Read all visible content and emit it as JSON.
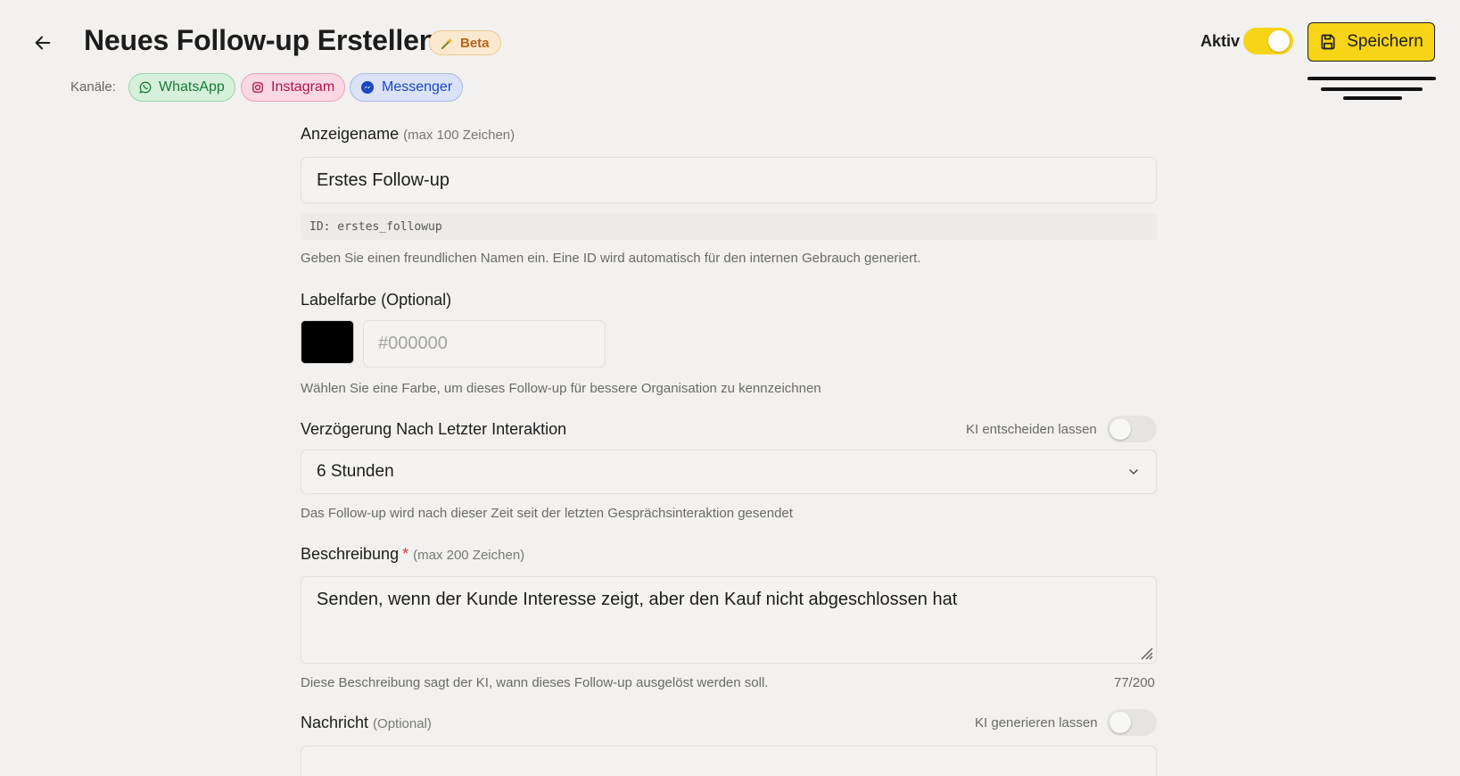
{
  "header": {
    "title": "Neues Follow-up Erstellen",
    "beta_badge": "Beta",
    "channels_label": "Kanäle:",
    "channels": [
      {
        "label": "WhatsApp",
        "icon": "whatsapp-icon",
        "color": "#187a33"
      },
      {
        "label": "Instagram",
        "icon": "instagram-icon",
        "color": "#b2124f"
      },
      {
        "label": "Messenger",
        "icon": "messenger-icon",
        "color": "#1d45c0"
      }
    ],
    "active_label": "Aktiv",
    "active_on": true,
    "save_label": "Speichern",
    "accent_color": "#f7d416"
  },
  "form": {
    "display_name": {
      "label": "Anzeigename",
      "hint": "(max 100 Zeichen)",
      "value": "Erstes Follow-up",
      "id_text": "ID: erstes_followup",
      "help": "Geben Sie einen freundlichen Namen ein. Eine ID wird automatisch für den internen Gebrauch generiert."
    },
    "label_color": {
      "label": "Labelfarbe (Optional)",
      "swatch_color": "#000000",
      "placeholder": "#000000",
      "help": "Wählen Sie eine Farbe, um dieses Follow-up für bessere Organisation zu kennzeichnen"
    },
    "delay": {
      "label": "Verzögerung Nach Letzter Interaktion",
      "ai_toggle_label": "KI entscheiden lassen",
      "ai_toggle_on": false,
      "selected": "6 Stunden",
      "help": "Das Follow-up wird nach dieser Zeit seit der letzten Gesprächsinteraktion gesendet"
    },
    "description": {
      "label": "Beschreibung",
      "required_mark": "*",
      "hint": "(max 200 Zeichen)",
      "value": "Senden, wenn der Kunde Interesse zeigt, aber den Kauf nicht abgeschlossen hat",
      "help": "Diese Beschreibung sagt der KI, wann dieses Follow-up ausgelöst werden soll.",
      "counter": "77/200"
    },
    "message": {
      "label": "Nachricht",
      "hint": "(Optional)",
      "ai_toggle_label": "KI generieren lassen",
      "ai_toggle_on": false
    }
  }
}
